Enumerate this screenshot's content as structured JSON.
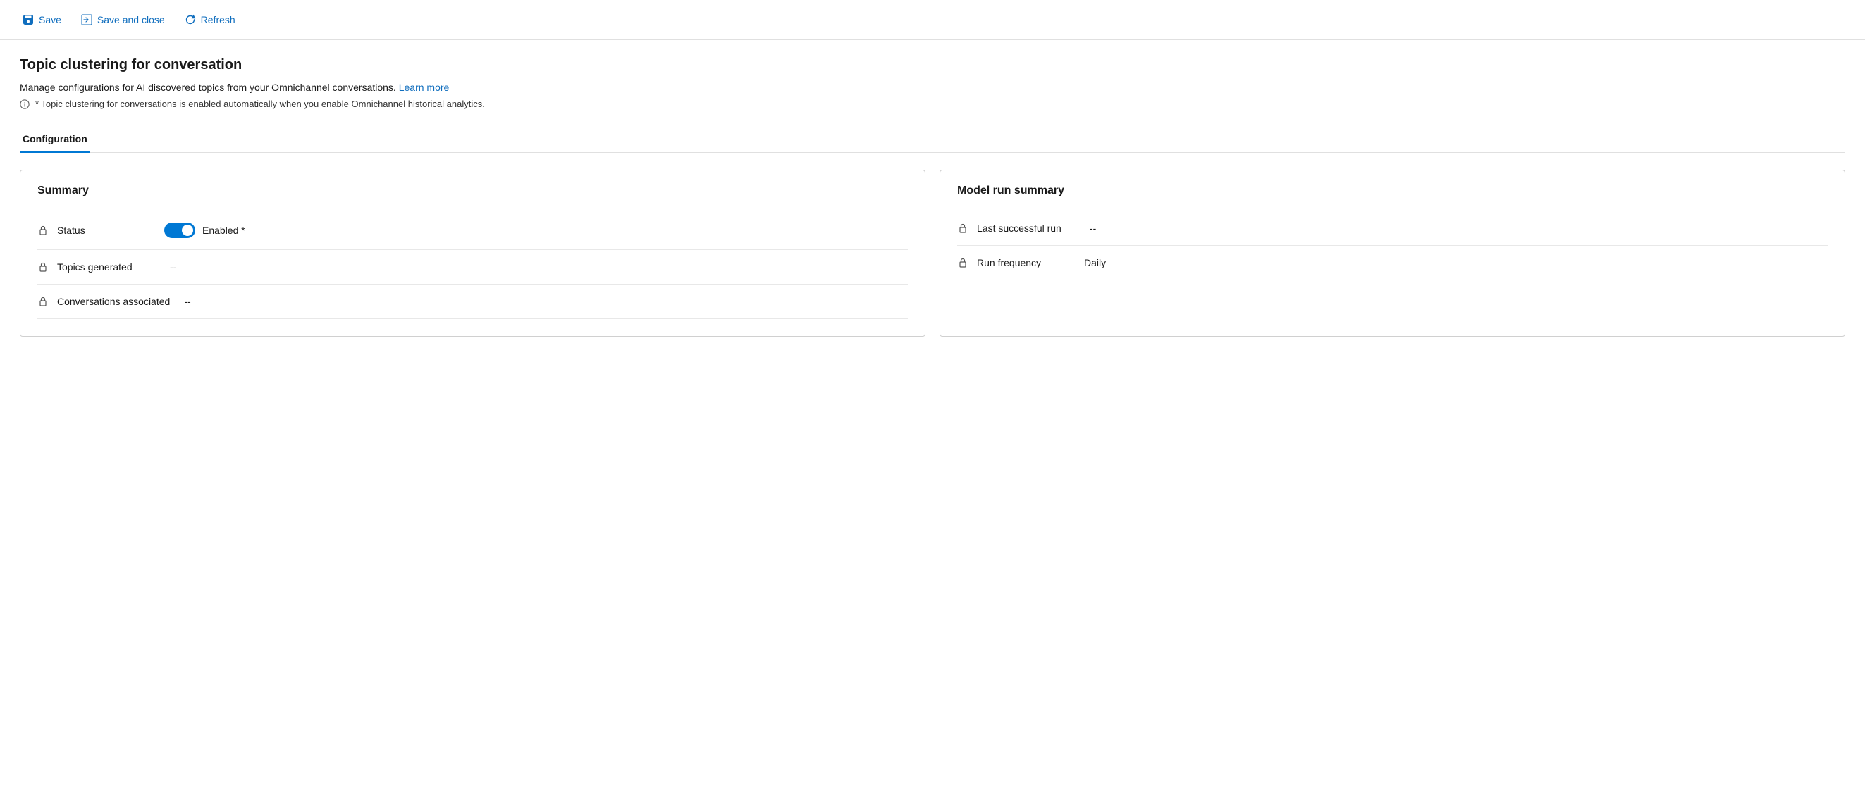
{
  "toolbar": {
    "save_label": "Save",
    "save_close_label": "Save and close",
    "refresh_label": "Refresh"
  },
  "page": {
    "title": "Topic clustering for conversation",
    "description": "Manage configurations for AI discovered topics from your Omnichannel conversations.",
    "learn_more_label": "Learn more",
    "info_note": "* Topic clustering for conversations is enabled automatically when you enable Omnichannel historical analytics."
  },
  "tabs": [
    {
      "label": "Configuration"
    }
  ],
  "summary_card": {
    "title": "Summary",
    "fields": [
      {
        "label": "Status",
        "type": "toggle",
        "toggle_state": "enabled",
        "value_label": "Enabled *"
      },
      {
        "label": "Topics generated",
        "value": "--"
      },
      {
        "label": "Conversations associated",
        "value": "--"
      }
    ]
  },
  "model_run_card": {
    "title": "Model run summary",
    "fields": [
      {
        "label": "Last successful run",
        "value": "--"
      },
      {
        "label": "Run frequency",
        "value": "Daily"
      }
    ]
  }
}
